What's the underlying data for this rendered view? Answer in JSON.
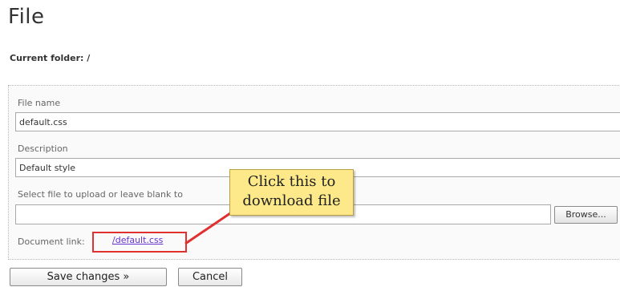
{
  "page": {
    "title": "File",
    "current_folder": "Current folder: /"
  },
  "form": {
    "file_name_label": "File name",
    "file_name_value": "default.css",
    "description_label": "Description",
    "description_value": "Default style",
    "upload_label": "Select file to upload or leave blank to",
    "browse_label": "Browse...",
    "document_link_label": "Document link:",
    "document_link_text": "/default.css"
  },
  "callout": {
    "line1": "Click this to",
    "line2": "download file",
    "color": "#fde98a",
    "arrow_color": "#e03030"
  },
  "actions": {
    "save_label": "Save changes »",
    "cancel_label": "Cancel"
  }
}
